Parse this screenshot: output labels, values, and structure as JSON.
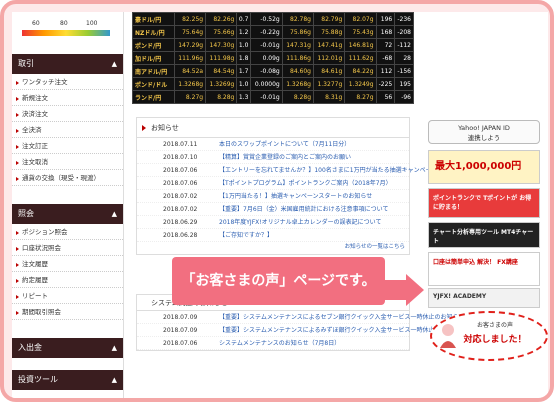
{
  "gauge": {
    "labels": [
      "60",
      "80",
      "100"
    ]
  },
  "sidebar": {
    "section1_title": "取引",
    "section1_items": [
      "ワンタッチ注文",
      "新規注文",
      "決済注文",
      "全決済",
      "注文訂正",
      "注文取消",
      "通貨の交換（現受・現渡）"
    ],
    "section2_title": "照会",
    "section2_items": [
      "ポジション照会",
      "口座状況照会",
      "注文履歴",
      "約定履歴",
      "リピート",
      "期間取引照会"
    ],
    "section3_title": "入出金",
    "section4_title": "投資ツール"
  },
  "rates": [
    [
      "豪ドル/円",
      "82.25g",
      "82.26g",
      "0.7",
      "-0.52g",
      "82.78g",
      "82.79g",
      "82.07g",
      "196",
      "-236"
    ],
    [
      "NZドル/円",
      "75.64g",
      "75.66g",
      "1.2",
      "-0.22g",
      "75.86g",
      "75.88g",
      "75.43g",
      "168",
      "-208"
    ],
    [
      "ポンド/円",
      "147.29g",
      "147.30g",
      "1.0",
      "-0.01g",
      "147.31g",
      "147.41g",
      "146.81g",
      "72",
      "-112"
    ],
    [
      "加ドル/円",
      "111.96g",
      "111.98g",
      "1.8",
      "0.09g",
      "111.86g",
      "112.01g",
      "111.62g",
      "-68",
      "28"
    ],
    [
      "南アドル/円",
      "84.52a",
      "84.54g",
      "1.7",
      "-0.08g",
      "84.60g",
      "84.61g",
      "84.22g",
      "112",
      "-156"
    ],
    [
      "ポンド/ドル",
      "1.3268g",
      "1.3269g",
      "1.0",
      "0.0000g",
      "1.3268g",
      "1.3277g",
      "1.3249g",
      "-225",
      "195"
    ],
    [
      "ランド/円",
      "8.27g",
      "8.28g",
      "1.3",
      "-0.01g",
      "8.28g",
      "8.31g",
      "8.27g",
      "56",
      "-96"
    ]
  ],
  "news": {
    "title": "お知らせ",
    "items": [
      {
        "date": "2018.07.11",
        "text": "本日のスワップポイントについて（7月11日分）"
      },
      {
        "date": "2018.07.10",
        "text": "【精算】賞賞企業登録のご案内とご案内のお願い"
      },
      {
        "date": "2018.07.06",
        "text": "【エントリーを忘れてませんか？】100名さまに1万円が当たる抽選キャンペーンは7月12日まで！"
      },
      {
        "date": "2018.07.06",
        "text": "【Tポイントプログラム】ポイントランクご案内（2018年7月）"
      },
      {
        "date": "2018.07.02",
        "text": "【1万円当たる！】抽選キャンペーンスタートのお知らせ"
      },
      {
        "date": "2018.07.02",
        "text": "【重要】7月6日（金）米国雇用統計における注意事項について"
      },
      {
        "date": "2018.06.29",
        "text": "2018年度YJFX!オリジナル卓上カレンダーの誤表記について"
      },
      {
        "date": "2018.06.28",
        "text": "【ご存知ですか？】"
      }
    ],
    "more": "お知らせの一覧はこちら"
  },
  "maintenance": {
    "title": "システム関連のお知らせ",
    "items": [
      {
        "date": "2018.07.09",
        "text": "【重要】システムメンテナンスによるセブン銀行クイック入金サービス一時休止のお知らせ"
      },
      {
        "date": "2018.07.09",
        "text": "【重要】システムメンテナンスによるみずほ銀行クイック入金サービス一時休止のお知らせ"
      },
      {
        "date": "2018.07.06",
        "text": "システムメンテナンスのお知らせ（7月8日）"
      }
    ]
  },
  "right": {
    "yahoo": "Yahoo! JAPAN ID\n連携しよう",
    "b1": "最大1,000,000円",
    "b2": "ポイントランクで Tポイントが お得に貯まる！",
    "b3": "チャート分析専用ツール MT4チャート",
    "b4": "口座は簡単申込 解決！ FX講座",
    "b5": "YJFX! ACADEMY",
    "voice_label": "お客さまの声",
    "voice_sub": "対応しました！"
  },
  "callout": "「お客さまの声」ページです。"
}
